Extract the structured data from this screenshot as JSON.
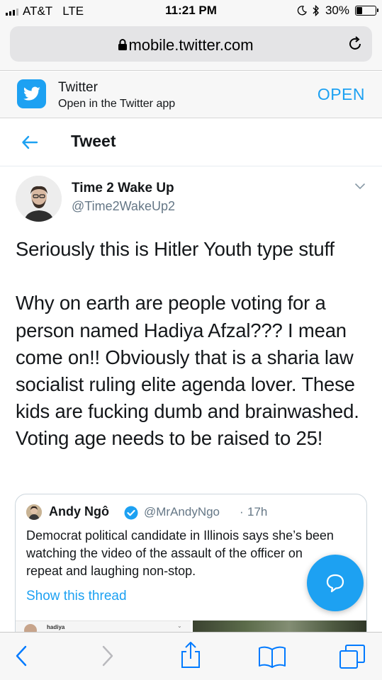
{
  "status_bar": {
    "carrier": "AT&T",
    "network": "LTE",
    "time": "11:21 PM",
    "battery_percent": "30%",
    "battery_level": 0.3,
    "icons": [
      "signal-icon",
      "moon-icon",
      "bluetooth-icon",
      "battery-icon"
    ]
  },
  "browser": {
    "url": "mobile.twitter.com",
    "icons": [
      "lock-icon",
      "reload-icon"
    ]
  },
  "app_banner": {
    "title": "Twitter",
    "subtitle": "Open in the Twitter app",
    "open_label": "OPEN",
    "icon": "twitter-bird-icon"
  },
  "header": {
    "title": "Tweet",
    "icon": "back-arrow-icon"
  },
  "tweet": {
    "author_name": "Time 2 Wake Up",
    "author_handle": "@Time2WakeUp2",
    "text": "Seriously this is Hitler Youth type stuff\n\nWhy on earth are people voting for a person named Hadiya Afzal??? I mean come on!! Obviously that is a sharia law socialist ruling elite agenda lover. These kids are fucking dumb and brainwashed. Voting age needs to be raised to 25!"
  },
  "quoted_tweet": {
    "author_name": "Andy Ngô",
    "author_handle": "@MrAndyNgo",
    "separator": "·",
    "time": "17h",
    "text": "Democrat political candidate in Illinois says she’s been watching the video of the assault of the officer on repeat and laughing non-stop.",
    "show_thread_label": "Show this thread",
    "media_label": "hadiya"
  },
  "toolbar": {
    "icons": [
      "back-icon",
      "forward-icon",
      "share-icon",
      "bookmarks-icon",
      "tabs-icon"
    ]
  },
  "colors": {
    "accent": "#1da1f2",
    "text": "#14171a",
    "secondary_text": "#657786",
    "ios_blue": "#007aff"
  }
}
